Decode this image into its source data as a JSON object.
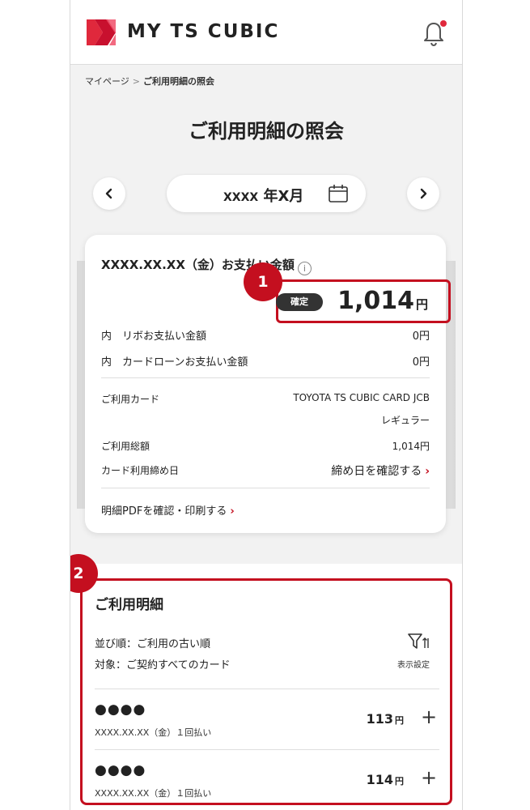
{
  "header": {
    "brand": "MY TS CUBIC",
    "brand_color": "#e0283c",
    "notification_dot_color": "#e0283c"
  },
  "breadcrumb": {
    "home": "マイページ",
    "separator": ">",
    "current": "ご利用明細の照会"
  },
  "page_title": "ご利用明細の照会",
  "month_nav": {
    "year_text": "XXXX",
    "year_suffix": "年X月"
  },
  "summary": {
    "pay_date_label": "XXXX.XX.XX（金）お支払い金額",
    "status_badge": "確定",
    "amount": "1,014",
    "amount_unit": "円",
    "revolving_label": "内　リボお支払い金額",
    "revolving_value": "0円",
    "cardloan_label": "内　カードローンお支払い金額",
    "cardloan_value": "0円",
    "card_label": "ご利用カード",
    "card_name": "TOYOTA TS CUBIC CARD JCB",
    "card_type": "レギュラー",
    "total_label": "ご利用総額",
    "total_value": "1,014円",
    "closing_label": "カード利用締め日",
    "closing_link": "締め日を確認する",
    "pdf_link": "明細PDFを確認・印刷する"
  },
  "callouts": {
    "first": "1",
    "second": "2",
    "color": "#c40f1f"
  },
  "details": {
    "title": "ご利用明細",
    "sort": "並び順：ご利用の古い順",
    "target": "対象：ご契約すべてのカード",
    "display_settings": "表示設定",
    "transactions": [
      {
        "merchant": "●●●●",
        "date": "XXXX.XX.XX（金）１回払い",
        "amount": "113",
        "unit": "円"
      },
      {
        "merchant": "●●●●",
        "date": "XXXX.XX.XX（金）１回払い",
        "amount": "114",
        "unit": "円"
      }
    ]
  }
}
